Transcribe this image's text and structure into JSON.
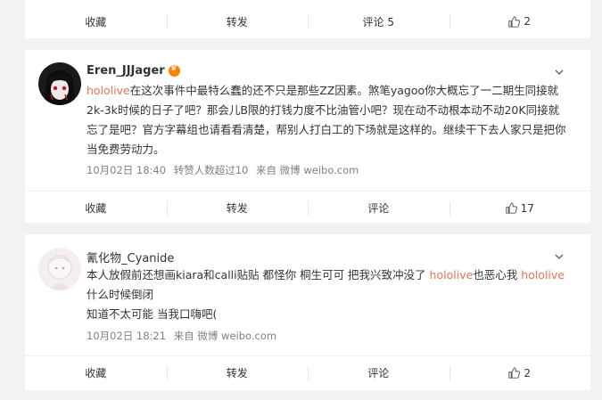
{
  "top_card": {
    "actions": {
      "favorite": "收藏",
      "repost": "转发",
      "comment": "评论 5",
      "like_count": "2"
    }
  },
  "post1": {
    "username": "Eren_JJJager",
    "content": [
      {
        "text": "hololive",
        "hl": true
      },
      {
        "text": "在这次事件中最特么蠢的还不只是那些ZZ因素。煞笔yagoo你大概忘了一二期生同接就2k-3k时候的日子了吧？那会儿B限的打钱力度不比油管小吧？现在动不动根本动不动20K同接就忘了是吧？官方字幕组也请看看清楚，帮别人打白工的下场就是这样的。继续干下去人家只是把你当免费劳动力。",
        "hl": false
      }
    ],
    "meta": {
      "date": "10月02日 18:40",
      "likes_note": "转赞人数超过10",
      "source": "来自 微博 weibo.com"
    },
    "actions": {
      "favorite": "收藏",
      "repost": "转发",
      "comment": "评论",
      "like_count": "17"
    }
  },
  "post2": {
    "username": "氰化物_Cyanide",
    "content": [
      {
        "text": "本人放假前还想画kiara和calli贴贴 都怪你 桐生可可 把我兴致冲没了 ",
        "hl": false
      },
      {
        "text": "hololive",
        "hl": true
      },
      {
        "text": "也恶心我 ",
        "hl": false
      },
      {
        "text": "hololive",
        "hl": true
      },
      {
        "text": "什么时候倒闭",
        "hl": false
      }
    ],
    "content_line2": "知道不太可能 当我口嗨吧(",
    "meta": {
      "date": "10月02日 18:21",
      "source": "来自 微博 weibo.com"
    },
    "actions": {
      "favorite": "收藏",
      "repost": "转发",
      "comment": "评论",
      "like_count": "2"
    }
  },
  "colors": {
    "highlight": "#eb7350",
    "meta": "#808080",
    "background": "#f2f2f5"
  }
}
